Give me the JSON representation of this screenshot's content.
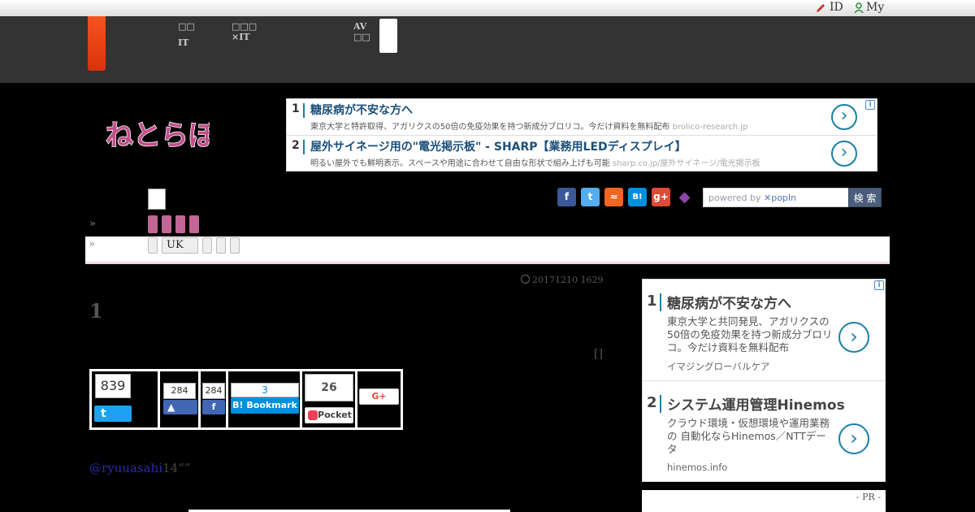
{
  "topbar": {
    "id_link": "ID",
    "my_link": "My"
  },
  "gnav": {
    "items": [
      {
        "l1": "□□",
        "l2": "IT"
      },
      {
        "l1": "□□□",
        "l2": "×IT"
      },
      {
        "l1": "AV",
        "l2": "□□"
      }
    ]
  },
  "ad_top": {
    "rows": [
      {
        "num": "1",
        "title": "糖尿病が不安な方へ",
        "desc": "東京大学と特許取得、アガリクスの50倍の免疫効果を持つ新成分ブロリコ。今だけ資料を無料配布",
        "src": "brolico-research.jp"
      },
      {
        "num": "2",
        "title": "屋外サイネージ用の\"電光掲示板\" - SHARP【業務用LEDディスプレイ】",
        "desc": "明るい屋外でも鮮明表示。スペースや用途に合わせて自由な形状で組み上げも可能",
        "src": "sharp.co.jp/屋外サイネージ/電光掲示板"
      }
    ],
    "arrow": "›",
    "info": "i"
  },
  "site_logo": {
    "text": "ねとらぼ",
    "color": "#c0508a"
  },
  "social": [
    {
      "icon": "facebook-icon",
      "glyph": "f",
      "color": "#3b5998"
    },
    {
      "icon": "twitter-icon",
      "glyph": "t",
      "color": "#55acee"
    },
    {
      "icon": "rss-icon",
      "glyph": "≈",
      "color": "#f26522"
    },
    {
      "icon": "hatena-icon",
      "glyph": "B!",
      "color": "#008fde"
    },
    {
      "icon": "googleplus-icon",
      "glyph": "g+",
      "color": "#dd4b39"
    },
    {
      "icon": "cat-icon",
      "glyph": "◆",
      "color": "#8e44ad"
    }
  ],
  "search": {
    "placeholder_prefix": "powered by ",
    "brand": "✕popIn",
    "button": "検 索"
  },
  "breadcrumb": {
    "raquo": "»",
    "pill_uk": "UK"
  },
  "article": {
    "date": "20171210 1629",
    "title": "1",
    "mark": "[]",
    "mention_handle": "@ryuuasahi",
    "mention_rest": "14“”"
  },
  "share": {
    "twitter_count": "839",
    "facebook_like_count": "284",
    "facebook_share_count": "284",
    "hatena_count": "3",
    "hatena_label": "B! Bookmark",
    "pocket_count": "26",
    "pocket_label": "Pocket",
    "gplus_label": "G+"
  },
  "ad_side": {
    "items": [
      {
        "num": "1",
        "title": "糖尿病が不安な方へ",
        "desc": "東京大学と共同発見、アガリクスの50倍の免疫効果を持つ新成分ブロリコ。今だけ資料を無料配布",
        "src": "イマジングローバルケア"
      },
      {
        "num": "2",
        "title": "システム運用管理Hinemos",
        "desc": "クラウド環境・仮想環境や運用業務の 自動化ならHinemos／NTTデータ",
        "src": "hinemos.info"
      }
    ],
    "arrow": "›",
    "info": "i"
  },
  "pr": {
    "label": "- PR -"
  },
  "colors": {
    "accent": "#f5541f",
    "nav_bg": "#333333",
    "link_blue": "#1a7fa6",
    "pink": "#c26696"
  }
}
